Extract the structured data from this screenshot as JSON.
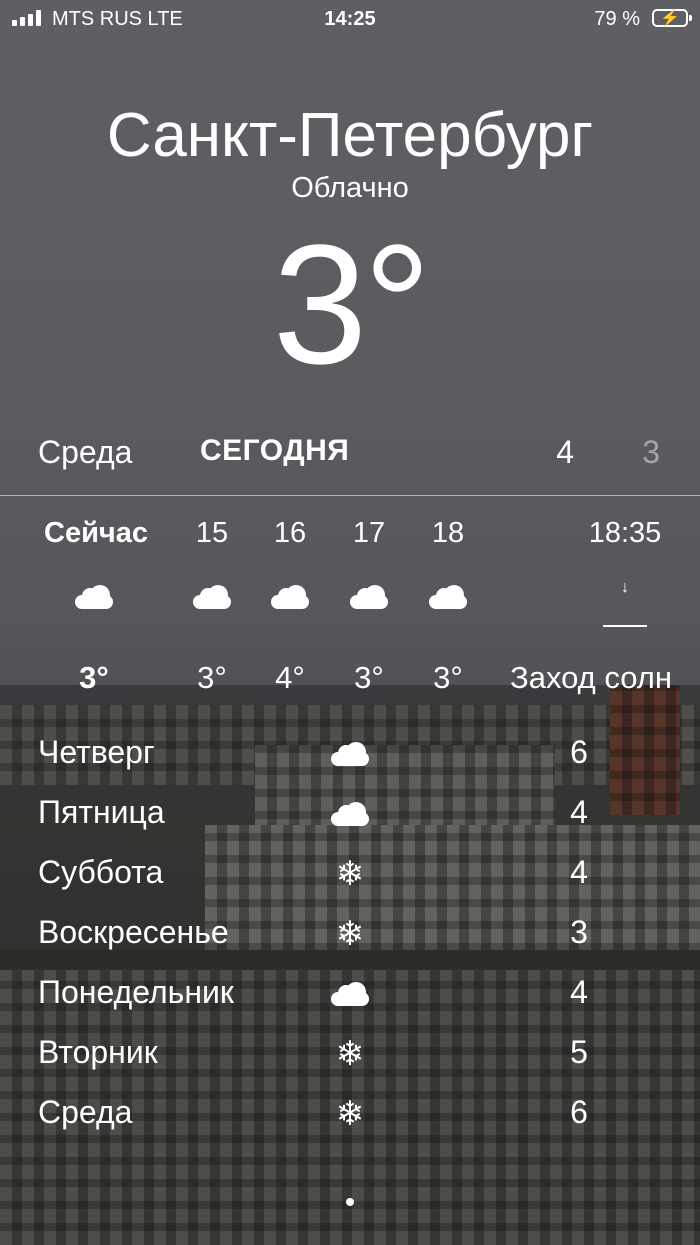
{
  "status_bar": {
    "carrier": "MTS RUS  LTE",
    "time": "14:25",
    "battery": "79 %"
  },
  "header": {
    "city": "Санкт-Петербург",
    "condition": "Облачно",
    "temperature": "3°"
  },
  "today": {
    "day": "Среда",
    "tag": "СЕГОДНЯ",
    "high": "4",
    "low": "3"
  },
  "hourly": [
    {
      "time": "Сейчас",
      "icon": "cloud-icon",
      "temp": "3°"
    },
    {
      "time": "15",
      "icon": "cloud-icon",
      "temp": "3°"
    },
    {
      "time": "16",
      "icon": "cloud-icon",
      "temp": "4°"
    },
    {
      "time": "17",
      "icon": "cloud-icon",
      "temp": "3°"
    },
    {
      "time": "18",
      "icon": "cloud-icon",
      "temp": "3°"
    },
    {
      "time": "18:35",
      "icon": "sunset-icon",
      "temp": "Заход солн"
    }
  ],
  "daily": [
    {
      "day": "Четверг",
      "icon": "cloud-icon",
      "temp": "6"
    },
    {
      "day": "Пятница",
      "icon": "cloud-icon",
      "temp": "4"
    },
    {
      "day": "Суббота",
      "icon": "snowflake-icon",
      "temp": "4"
    },
    {
      "day": "Воскресенье",
      "icon": "snowflake-icon",
      "temp": "3"
    },
    {
      "day": "Понедельник",
      "icon": "cloud-icon",
      "temp": "4"
    },
    {
      "day": "Вторник",
      "icon": "snowflake-icon",
      "temp": "5"
    },
    {
      "day": "Среда",
      "icon": "snowflake-icon",
      "temp": "6"
    }
  ]
}
